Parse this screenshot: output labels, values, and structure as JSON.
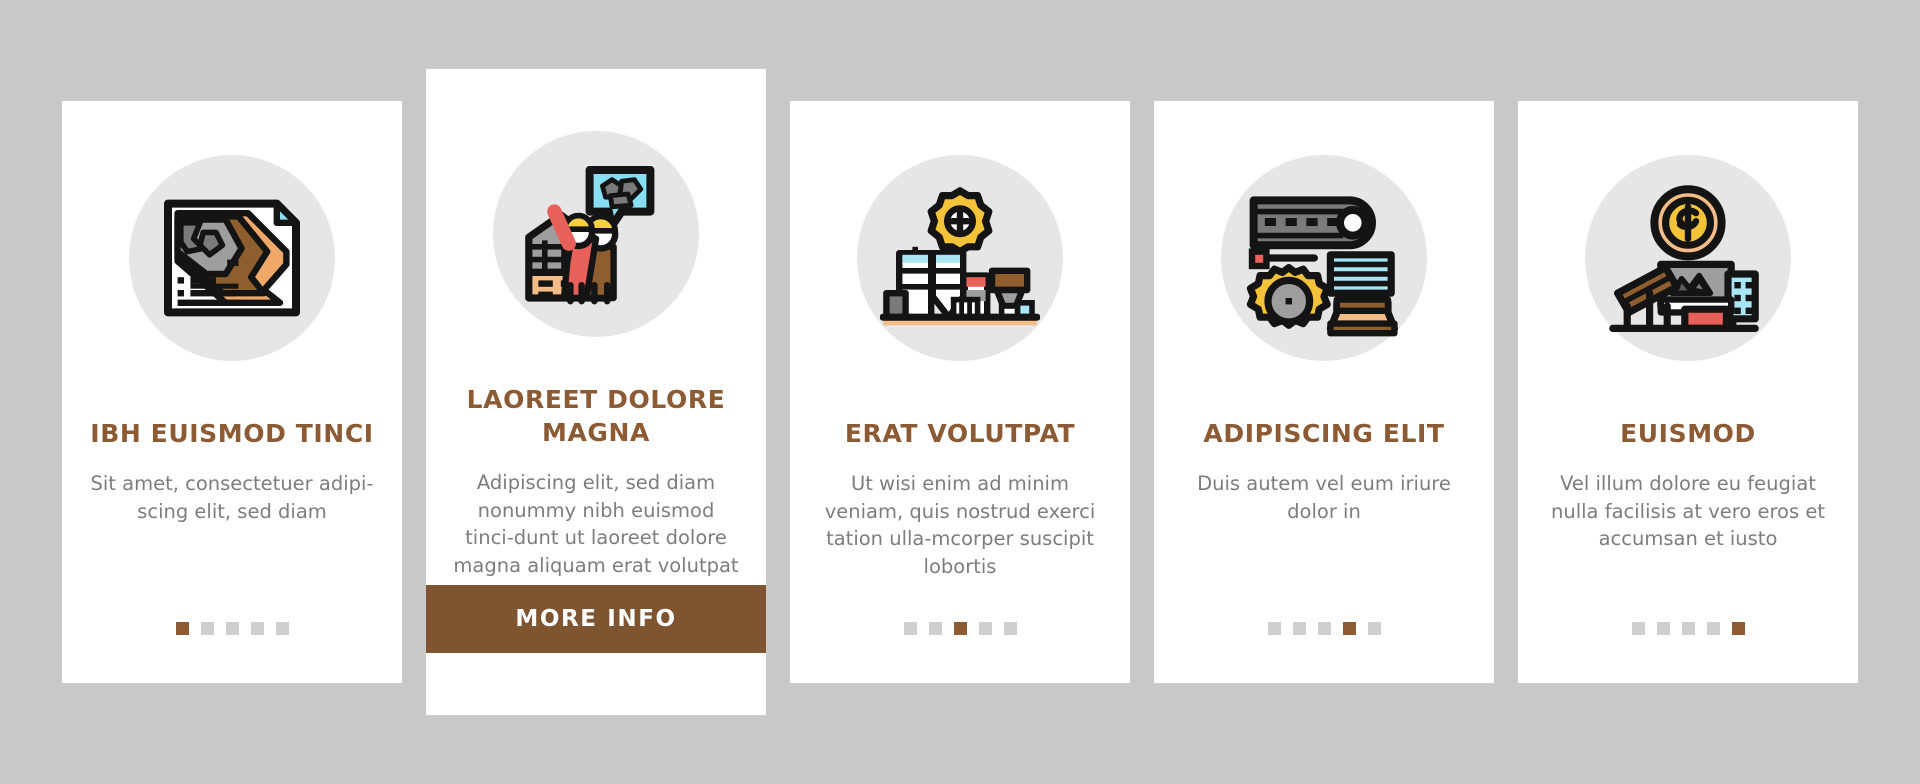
{
  "background_color": "#c9c9c9",
  "theme": {
    "card_bg": "#ffffff",
    "icon_circle_bg": "#e6e6e6",
    "title_color": "#8c5a33",
    "body_color": "#7d7d7d",
    "accent_color": "#7f5430",
    "dot_inactive_color": "#cfcfcf"
  },
  "cards": [
    {
      "icon": "geological-map-icon",
      "title": "IBH EUISMOD TINCI",
      "description": "Sit amet, consectetuer adipi-scing elit, sed diam",
      "dots_total": 5,
      "dot_active_index": 0,
      "featured": false
    },
    {
      "icon": "mine-workers-icon",
      "title": "LAOREET DOLORE MAGNA",
      "description": "Adipiscing elit, sed diam nonummy nibh euismod tinci-dunt ut laoreet dolore magna aliquam erat volutpat",
      "button_label": "MORE INFO",
      "featured": true
    },
    {
      "icon": "processing-plant-icon",
      "title": "ERAT VOLUTPAT",
      "description": "Ut wisi enim ad minim veniam, quis nostrud exerci tation ulla-mcorper suscipit lobortis",
      "dots_total": 5,
      "dot_active_index": 2,
      "featured": false
    },
    {
      "icon": "mining-equipment-icon",
      "title": "ADIPISCING ELIT",
      "description": "Duis autem vel eum iriure dolor in",
      "dots_total": 5,
      "dot_active_index": 3,
      "featured": false
    },
    {
      "icon": "ore-conveyor-profit-icon",
      "title": "EUISMOD",
      "description": "Vel illum dolore eu feugiat nulla facilisis at vero eros et accumsan et iusto",
      "dots_total": 5,
      "dot_active_index": 4,
      "featured": false
    }
  ]
}
